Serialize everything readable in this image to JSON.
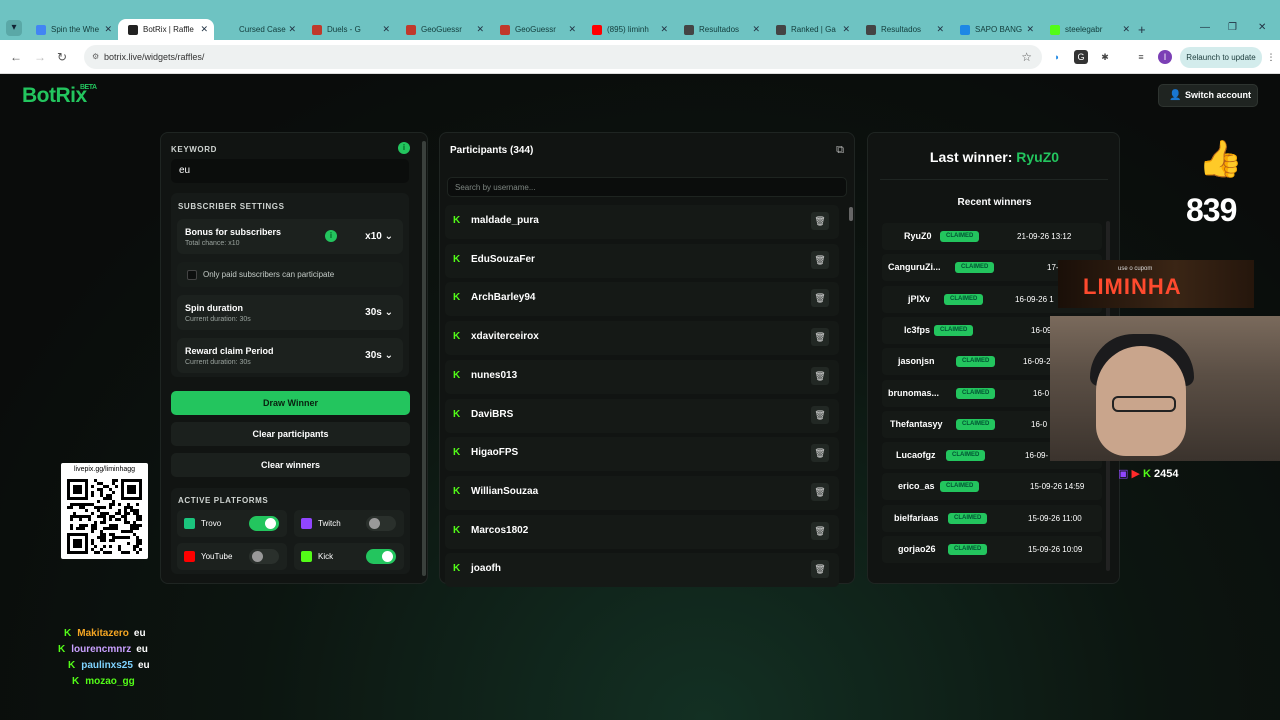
{
  "browser": {
    "tabs": [
      {
        "label": "Spin the Whe",
        "color": "#4285f4"
      },
      {
        "label": "BotRix | Raffle",
        "color": "#222222"
      },
      {
        "label": "Cursed Case",
        "color": "#6ec3c2"
      },
      {
        "label": "Duels - G",
        "color": "#c0392b"
      },
      {
        "label": "GeoGuessr",
        "color": "#c0392b"
      },
      {
        "label": "GeoGuessr",
        "color": "#c0392b"
      },
      {
        "label": "(895) liminh",
        "color": "#ff0000"
      },
      {
        "label": "Resultados",
        "color": "#444444"
      },
      {
        "label": "Ranked | Ga",
        "color": "#444444"
      },
      {
        "label": "Resultados",
        "color": "#444444"
      },
      {
        "label": "SAPO BANG",
        "color": "#1e88e5"
      },
      {
        "label": "steelegabr",
        "color": "#53fc18"
      }
    ],
    "url": "botrix.live/widgets/raffles/",
    "relaunch_label": "Relaunch to update"
  },
  "header": {
    "logo": "BotRix",
    "logo_badge": "BETA",
    "switch_account": "Switch account"
  },
  "settings": {
    "keyword_label": "KEYWORD",
    "keyword_value": "eu",
    "subscriber_label": "SUBSCRIBER SETTINGS",
    "bonus_title": "Bonus for subscribers",
    "bonus_sub": "Total chance: x10",
    "bonus_value": "x10",
    "paid_only": "Only paid subscribers can participate",
    "spin_title": "Spin duration",
    "spin_sub": "Current duration: 30s",
    "spin_value": "30s",
    "reward_title": "Reward claim Period",
    "reward_sub": "Current duration: 30s",
    "reward_value": "30s",
    "draw_winner": "Draw Winner",
    "clear_participants": "Clear participants",
    "clear_winners": "Clear winners",
    "platforms_label": "ACTIVE PLATFORMS",
    "platforms": [
      {
        "name": "Trovo",
        "on": true,
        "color": "#1bc47d",
        "icon": "trovo-icon"
      },
      {
        "name": "Twitch",
        "on": false,
        "color": "#9146ff",
        "icon": "twitch-icon"
      },
      {
        "name": "YouTube",
        "on": false,
        "color": "#ff0000",
        "icon": "youtube-icon"
      },
      {
        "name": "Kick",
        "on": true,
        "color": "#53fc18",
        "icon": "kick-icon"
      }
    ]
  },
  "participants": {
    "title": "Participants (344)",
    "search_placeholder": "Search by username...",
    "list": [
      "maldade_pura",
      "EduSouzaFer",
      "ArchBarley94",
      "xdaviterceirox",
      "nunes013",
      "DaviBRS",
      "HigaoFPS",
      "WillianSouzaa",
      "Marcos1802",
      "joaofh"
    ]
  },
  "winners": {
    "last_winner_label": "Last winner:",
    "last_winner_name": "RyuZ0",
    "recent_label": "Recent winners",
    "claimed_label": "CLAIMED",
    "list": [
      {
        "name": "RyuZ0",
        "date": "21-09-26 13:12"
      },
      {
        "name": "CanguruZi...",
        "date": "17-09-26"
      },
      {
        "name": "jPIXv",
        "date": "16-09-26 1"
      },
      {
        "name": "lc3fps",
        "date": "16-09-26"
      },
      {
        "name": "jasonjsn",
        "date": "16-09-2"
      },
      {
        "name": "brunomas...",
        "date": "16-0"
      },
      {
        "name": "Thefantasyy",
        "date": "16-0"
      },
      {
        "name": "Lucaofgz",
        "date": "16-09-"
      },
      {
        "name": "erico_as",
        "date": "15-09-26 14:59"
      },
      {
        "name": "bielfariaas",
        "date": "15-09-26 11:00"
      },
      {
        "name": "gorjao26",
        "date": "15-09-26 10:09"
      }
    ]
  },
  "overlay": {
    "like_count": "839",
    "promo_top": "use o cupom",
    "promo_code": "LIMINHA",
    "viewer_count": "2454",
    "qr_caption": "livepix.gg/liminhagg",
    "chat": [
      {
        "user": "Makitazero",
        "msg": "eu",
        "color": "#f5a623"
      },
      {
        "user": "lourencmnrz",
        "msg": "eu",
        "color": "#c9a0ff"
      },
      {
        "user": "paulinxs25",
        "msg": "eu",
        "color": "#7fd3ff"
      },
      {
        "user": "mozao_gg",
        "msg": "",
        "color": "#53fc18"
      }
    ]
  }
}
